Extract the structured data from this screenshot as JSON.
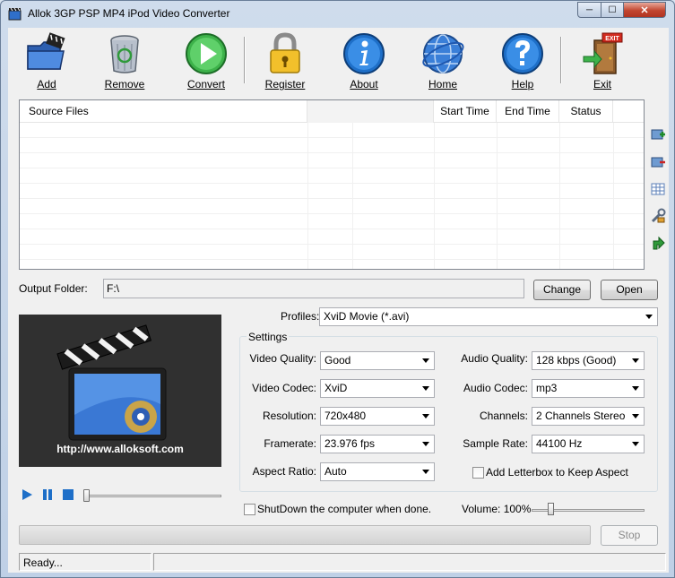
{
  "window": {
    "title": "Allok 3GP PSP MP4 iPod Video Converter",
    "minimize_glyph": "─",
    "maximize_glyph": "☐",
    "close_glyph": "✕"
  },
  "toolbar": {
    "add": "Add",
    "remove": "Remove",
    "convert": "Convert",
    "register": "Register",
    "about": "About",
    "home": "Home",
    "help": "Help",
    "exit": "Exit",
    "exit_sign": "EXIT"
  },
  "filelist": {
    "columns": [
      "Source Files",
      "",
      "Start Time",
      "End Time",
      "Status"
    ]
  },
  "output": {
    "label": "Output Folder:",
    "value": "F:\\",
    "change": "Change",
    "open": "Open"
  },
  "preview": {
    "url": "http://www.alloksoft.com"
  },
  "profiles": {
    "label": "Profiles:",
    "value": "XviD Movie (*.avi)"
  },
  "settings": {
    "legend": "Settings",
    "video_quality_label": "Video Quality:",
    "video_quality": "Good",
    "video_codec_label": "Video Codec:",
    "video_codec": "XviD",
    "resolution_label": "Resolution:",
    "resolution": "720x480",
    "framerate_label": "Framerate:",
    "framerate": "23.976 fps",
    "aspect_label": "Aspect Ratio:",
    "aspect": "Auto",
    "audio_quality_label": "Audio Quality:",
    "audio_quality": "128 kbps (Good)",
    "audio_codec_label": "Audio Codec:",
    "audio_codec": "mp3",
    "channels_label": "Channels:",
    "channels": "2 Channels Stereo",
    "sample_rate_label": "Sample Rate:",
    "sample_rate": "44100 Hz",
    "letterbox_label": "Add Letterbox to Keep Aspect",
    "letterbox_checked": false
  },
  "bottom": {
    "shutdown_label": "ShutDown the computer when done.",
    "shutdown_checked": false,
    "volume_label": "Volume: 100%",
    "volume_value": 100,
    "progress": 0,
    "stop": "Stop"
  },
  "status": {
    "text": "Ready...",
    "text2": ""
  },
  "colors": {
    "accent_blue": "#1e6fc8",
    "progress_bg": "#d3d3d3",
    "window_frame": "#bfd0e6"
  }
}
